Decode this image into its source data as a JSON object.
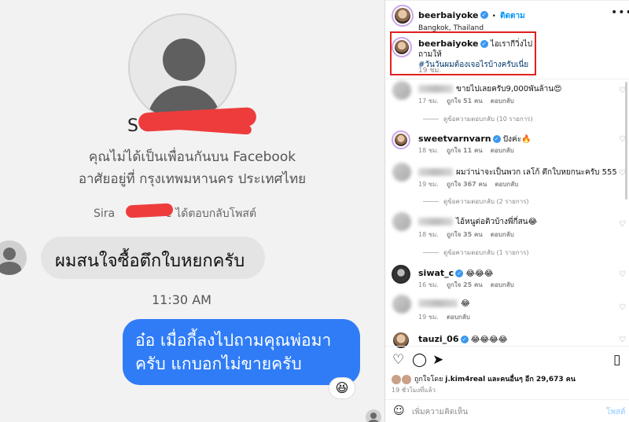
{
  "messenger": {
    "name_prefix": "S",
    "not_friends": "คุณไม่ได้เป็นเพื่อนกันบน Facebook",
    "lives_in": "อาศัยอยู่ที่ กรุงเทพมหานคร ประเทศไทย",
    "reply_prefix": "Sira",
    "reply_suffix": "e ได้ตอบกลับโพสต์",
    "incoming_message": "ผมสนใจซื้อตึกใบหยกครับ",
    "timestamp": "11:30 AM",
    "outgoing_line1": "อ๋อ เมื่อกี้ลงไปถามคุณพ่อมา",
    "outgoing_line2": "ครับ แกบอกไม่ขายครับ",
    "reaction": "😆"
  },
  "instagram": {
    "header": {
      "username": "beerbaiyoke",
      "separator": "•",
      "follow_label": "ติดตาม",
      "location": "Bangkok, Thailand",
      "more": "•••"
    },
    "caption": {
      "username": "beerbaiyoke",
      "text": "ไอเรากีวิ่งไปถามให้",
      "hashtag": "#วันวันผมต้องเจอไรบ้างครับเนี่ย",
      "time": "19 ชม."
    },
    "comments": [
      {
        "text": "ขายไปเลยครับ9,000พันล้าน😍",
        "time": "17 ชม.",
        "likes": "ถูกใจ 51 คน",
        "reply": "ตอบกลับ",
        "view_replies": "ดูข้อความตอบกลับ (10 รายการ)"
      },
      {
        "username": "sweetvarnvarn",
        "text": "ปังค่ะ🔥",
        "time": "18 ชม.",
        "likes": "ถูกใจ 11 คน",
        "reply": "ตอบกลับ"
      },
      {
        "text": "ผมว่าน่าจะเป็นพวก เลโก้ ตึกใบหยกนะครับ 555",
        "time": "19 ชม.",
        "likes": "ถูกใจ 367 คน",
        "reply": "ตอบกลับ",
        "view_replies": "ดูข้อความตอบกลับ (2 รายการ)"
      },
      {
        "text": "ไอ้หนูต่อติวบ้างพี่กี่สน😂",
        "time": "18 ชม.",
        "likes": "ถูกใจ 35 คน",
        "reply": "ตอบกลับ",
        "view_replies": "ดูข้อความตอบกลับ (1 รายการ)"
      },
      {
        "username": "siwat_c",
        "text": "😂😂😂",
        "time": "16 ชม.",
        "likes": "ถูกใจ 25 คน",
        "reply": "ตอบกลับ"
      },
      {
        "text": "😂",
        "time": "19 ชม.",
        "reply": "ตอบกลับ"
      },
      {
        "username": "tauzi_06",
        "text": "😂😂😂😂"
      }
    ],
    "liked_by": {
      "prefix": "ถูกใจโดย",
      "user": "j.kim4real",
      "suffix": "และคนอื่นๆ อีก 29,673 คน"
    },
    "posted_ago": "19 ชั่วโมงที่แล้ว",
    "comment_placeholder": "เพิ่มความคิดเห็น",
    "post_label": "โพสต์",
    "icons": {
      "like": "heart-icon",
      "comment": "comment-icon",
      "share": "share-icon",
      "save": "bookmark-icon",
      "emoji": "emoji-icon"
    },
    "accent": "#0095f6",
    "highlight_color": "#e02020"
  }
}
